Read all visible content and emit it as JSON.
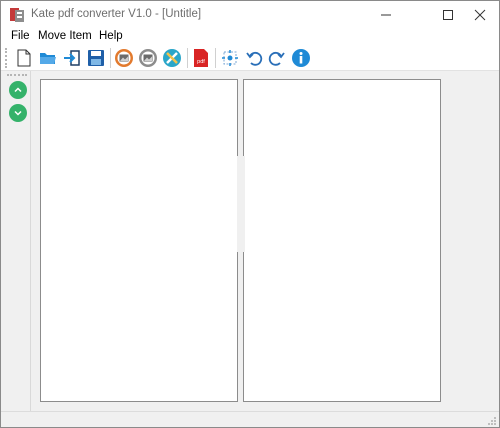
{
  "window": {
    "title": "Kate pdf converter V1.0 - [Untitle]"
  },
  "menu": {
    "file": "File",
    "move_item": "Move Item",
    "help": "Help"
  },
  "toolbar": {
    "icons": [
      "new-document-icon",
      "open-folder-icon",
      "import-icon",
      "save-icon",
      "image-orange-icon",
      "image-gray-icon",
      "tools-icon",
      "pdf-icon",
      "fit-view-icon",
      "undo-icon",
      "redo-icon",
      "info-icon"
    ],
    "pdf_badge": "pdf"
  },
  "side_panel": {
    "icons": [
      "move-up-icon",
      "move-down-icon"
    ]
  },
  "colors": {
    "accent_blue": "#1f8ad6",
    "green": "#34b26a",
    "pdf_red": "#d92424",
    "orange": "#e27a2e"
  }
}
